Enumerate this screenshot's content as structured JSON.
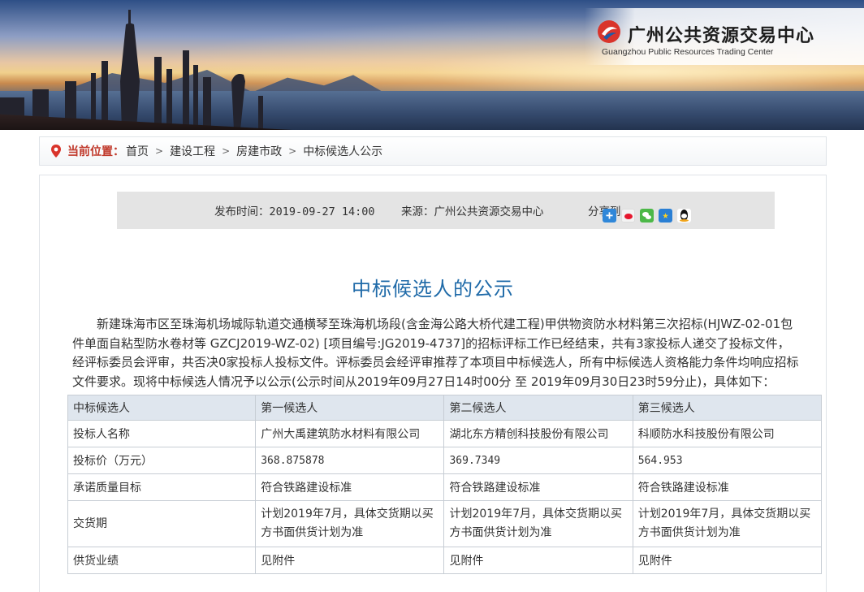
{
  "header": {
    "org_name_cn": "广州公共资源交易中心",
    "org_name_en": "Guangzhou Public Resources Trading Center"
  },
  "breadcrumb": {
    "current_label": "当前位置：",
    "items": [
      "首页",
      "建设工程",
      "房建市政",
      "中标候选人公示"
    ]
  },
  "info": {
    "publish_time": "发布时间：2019-09-27 14:00",
    "source": "来源：广州公共资源交易中心",
    "share_label": "分享到"
  },
  "share_icons": [
    "plus-share-icon",
    "weibo-icon",
    "wechat-icon",
    "qzone-icon",
    "qq-icon"
  ],
  "article": {
    "title": "中标候选人的公示",
    "paragraph": "新建珠海市区至珠海机场城际轨道交通横琴至珠海机场段(含金海公路大桥代建工程)甲供物资防水材料第三次招标(HJWZ-02-01包件单面自粘型防水卷材等 GZCJ2019-WZ-02) [项目编号:JG2019-4737]的招标评标工作已经结束，共有3家投标人递交了投标文件，经评标委员会评审，共否决0家投标人投标文件。评标委员会经评审推荐了本项目中标候选人，所有中标候选人资格能力条件均响应招标文件要求。现将中标候选人情况予以公示(公示时间从2019年09月27日14时00分 至 2019年09月30日23时59分止)，具体如下："
  },
  "table": {
    "headers": [
      "中标候选人",
      "第一候选人",
      "第二候选人",
      "第三候选人"
    ],
    "rows": [
      {
        "label": "投标人名称",
        "c1": "广州大禹建筑防水材料有限公司",
        "c2": "湖北东方精创科技股份有限公司",
        "c3": "科顺防水科技股份有限公司"
      },
      {
        "label": "投标价（万元）",
        "c1": "368.875878",
        "c2": "369.7349",
        "c3": "564.953"
      },
      {
        "label": "承诺质量目标",
        "c1": "符合铁路建设标准",
        "c2": "符合铁路建设标准",
        "c3": "符合铁路建设标准"
      },
      {
        "label": "交货期",
        "c1": "计划2019年7月，具体交货期以买方书面供货计划为准",
        "c2": "计划2019年7月，具体交货期以买方书面供货计划为准",
        "c3": "计划2019年7月，具体交货期以买方书面供货计划为准"
      },
      {
        "label": "供货业绩",
        "c1": "见附件",
        "c2": "见附件",
        "c3": "见附件"
      }
    ]
  },
  "colors": {
    "title_blue": "#1f6aa8",
    "breadcrumb_red": "#c0392b",
    "table_header_bg": "#dfe6ee",
    "infobar_bg": "#e4e4e4"
  }
}
